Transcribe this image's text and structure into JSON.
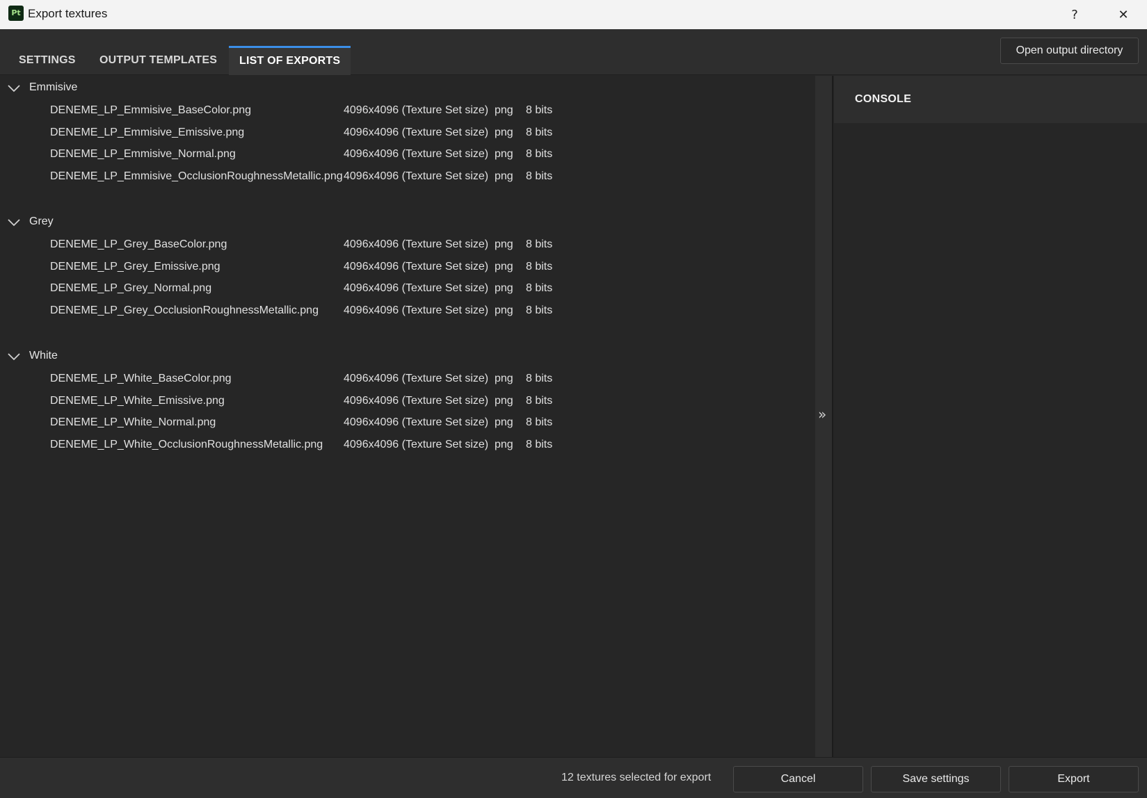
{
  "window": {
    "app_icon_text": "Pt",
    "title": "Export textures",
    "help_label": "?",
    "close_label": "✕"
  },
  "tabs": [
    {
      "label": "SETTINGS",
      "active": false
    },
    {
      "label": "OUTPUT TEMPLATES",
      "active": false
    },
    {
      "label": "LIST OF EXPORTS",
      "active": true
    }
  ],
  "toolbar": {
    "open_output_directory": "Open output directory"
  },
  "groups": [
    {
      "name": "Emmisive",
      "files": [
        {
          "file": "DENEME_LP_Emmisive_BaseColor.png",
          "size": "4096x4096 (Texture Set size)",
          "format": "png",
          "bits": "8 bits"
        },
        {
          "file": "DENEME_LP_Emmisive_Emissive.png",
          "size": "4096x4096 (Texture Set size)",
          "format": "png",
          "bits": "8 bits"
        },
        {
          "file": "DENEME_LP_Emmisive_Normal.png",
          "size": "4096x4096 (Texture Set size)",
          "format": "png",
          "bits": "8 bits"
        },
        {
          "file": "DENEME_LP_Emmisive_OcclusionRoughnessMetallic.png",
          "size": "4096x4096 (Texture Set size)",
          "format": "png",
          "bits": "8 bits"
        }
      ]
    },
    {
      "name": "Grey",
      "files": [
        {
          "file": "DENEME_LP_Grey_BaseColor.png",
          "size": "4096x4096 (Texture Set size)",
          "format": "png",
          "bits": "8 bits"
        },
        {
          "file": "DENEME_LP_Grey_Emissive.png",
          "size": "4096x4096 (Texture Set size)",
          "format": "png",
          "bits": "8 bits"
        },
        {
          "file": "DENEME_LP_Grey_Normal.png",
          "size": "4096x4096 (Texture Set size)",
          "format": "png",
          "bits": "8 bits"
        },
        {
          "file": "DENEME_LP_Grey_OcclusionRoughnessMetallic.png",
          "size": "4096x4096 (Texture Set size)",
          "format": "png",
          "bits": "8 bits"
        }
      ]
    },
    {
      "name": "White",
      "files": [
        {
          "file": "DENEME_LP_White_BaseColor.png",
          "size": "4096x4096 (Texture Set size)",
          "format": "png",
          "bits": "8 bits"
        },
        {
          "file": "DENEME_LP_White_Emissive.png",
          "size": "4096x4096 (Texture Set size)",
          "format": "png",
          "bits": "8 bits"
        },
        {
          "file": "DENEME_LP_White_Normal.png",
          "size": "4096x4096 (Texture Set size)",
          "format": "png",
          "bits": "8 bits"
        },
        {
          "file": "DENEME_LP_White_OcclusionRoughnessMetallic.png",
          "size": "4096x4096 (Texture Set size)",
          "format": "png",
          "bits": "8 bits"
        }
      ]
    }
  ],
  "splitter": {
    "icon": "double-chevron-right-icon",
    "glyph": "»"
  },
  "console": {
    "title": "CONSOLE"
  },
  "footer": {
    "status": "12 textures selected for export",
    "cancel_label": "Cancel",
    "save_settings_label": "Save settings",
    "export_label": "Export"
  },
  "colors": {
    "accent": "#3b8fe8",
    "background": "#262626",
    "titlebar": "#f3f3f3"
  }
}
